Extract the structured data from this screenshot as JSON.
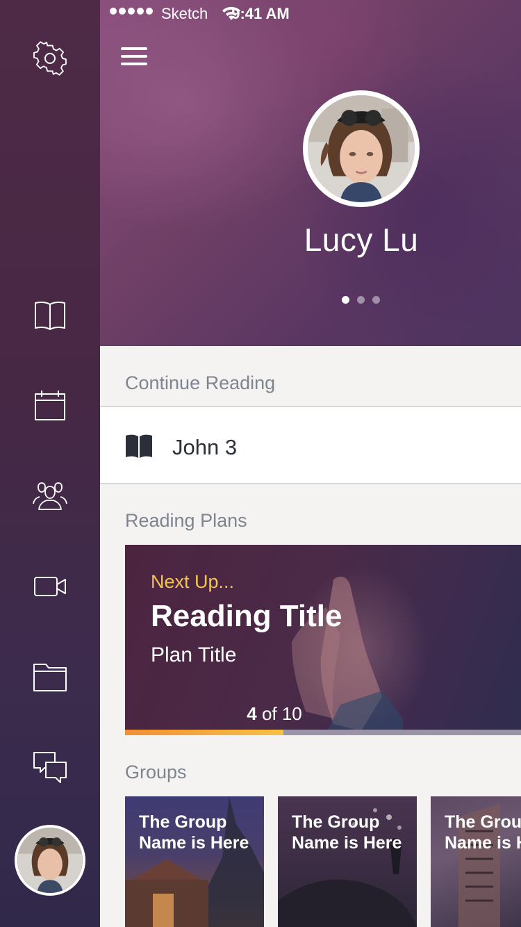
{
  "status_bar": {
    "carrier": "Sketch",
    "time": "9:41 AM"
  },
  "sidebar": {
    "items": [
      {
        "icon": "gear-icon"
      },
      {
        "icon": "book-open-icon"
      },
      {
        "icon": "calendar-icon"
      },
      {
        "icon": "people-icon"
      },
      {
        "icon": "video-camera-icon"
      },
      {
        "icon": "folder-icon"
      },
      {
        "icon": "chat-bubbles-icon"
      }
    ]
  },
  "profile": {
    "name": "Lucy Lu",
    "page_count": 3,
    "active_page": 1
  },
  "continue_reading": {
    "label": "Continue Reading",
    "item": "John 3"
  },
  "reading_plans": {
    "label": "Reading Plans",
    "card": {
      "next_up": "Next Up...",
      "title": "Reading Title",
      "plan_title": "Plan Title",
      "progress_current": "4",
      "progress_suffix": "of 10",
      "progress_fraction": 0.4
    }
  },
  "groups": {
    "label": "Groups",
    "items": [
      {
        "name": "The Group Name is Here"
      },
      {
        "name": "The Group Name is Here"
      },
      {
        "name": "The Group Name is Here"
      }
    ]
  },
  "colors": {
    "accent_yellow": "#f4c452",
    "progress_start": "#f08f35",
    "sidebar": "#472844"
  }
}
